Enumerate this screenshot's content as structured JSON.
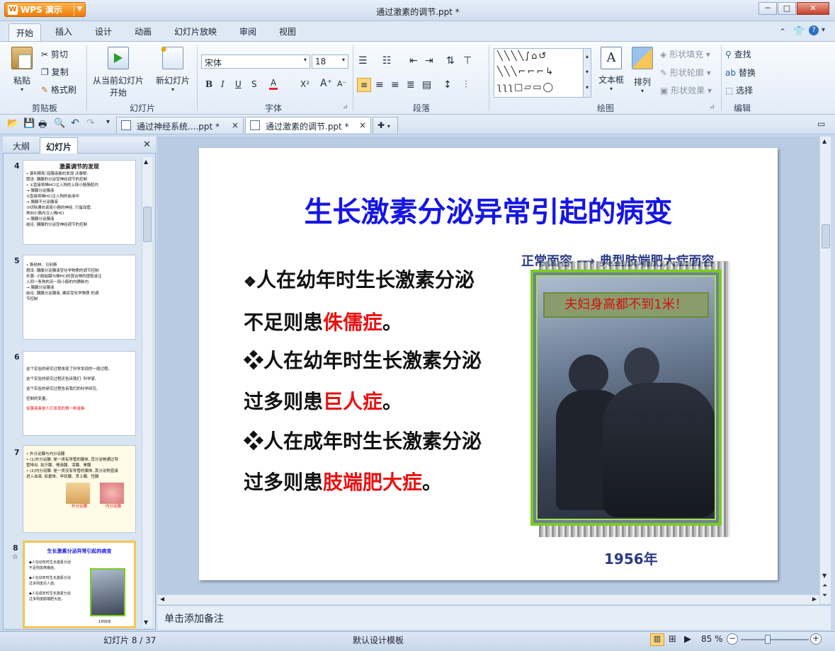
{
  "app": {
    "logo": "WPS 演示",
    "doc_title": "通过激素的调节.ppt *"
  },
  "window": {
    "min": "─",
    "max": "□",
    "close": "✕"
  },
  "menu": [
    "开始",
    "插入",
    "设计",
    "动画",
    "幻灯片放映",
    "审阅",
    "视图"
  ],
  "ribbon": {
    "clipboard": {
      "label": "剪贴板",
      "paste": "粘贴",
      "cut": "剪切",
      "copy": "复制",
      "format_painter": "格式刷"
    },
    "slides": {
      "label": "幻灯片",
      "from_current": "从当前幻灯片",
      "start": "开始",
      "new_slide": "新幻灯片"
    },
    "font": {
      "label": "字体",
      "name": "宋体",
      "size": "18"
    },
    "paragraph": {
      "label": "段落"
    },
    "drawing": {
      "label": "绘图",
      "textbox": "文本框",
      "arrange": "排列",
      "shape_fill": "形状填充",
      "shape_outline": "形状轮廓",
      "shape_effect": "形状效果"
    },
    "editing": {
      "label": "编辑",
      "find": "查找",
      "replace": "替换",
      "select": "选择"
    }
  },
  "doc_tabs": [
    {
      "label": "通过神经系统....ppt *"
    },
    {
      "label": "通过激素的调节.ppt *"
    }
  ],
  "left_panel": {
    "tab_outline": "大纲",
    "tab_slides": "幻灯片"
  },
  "thumbnails": [
    {
      "num": "4",
      "title": "激素调节的发现",
      "lines": [
        "• 斐利斯和 促胰液素的发现   沃泰默:",
        "假设: 胰腺的分泌受神经调节的控制",
        "• ①直接将稀HCl注入狗的上段小肠肠腔内",
        "  → 胰腺分泌胰液",
        "  ②直接将稀HCl注入狗的血液中",
        "  → 胰腺不分泌胰液",
        "  ③切除通向该段小肠的神经, 只留血管,",
        "  再向小肠内注入稀HCl",
        "  → 胰腺分泌胰液",
        "结论: 胰腺的分泌受神经调节的控制"
      ]
    },
    {
      "num": "5",
      "lines": [
        "• 斯他林、贝利斯",
        "假设: 胰腺分泌胰液受化学物质的调节控制",
        "步骤: 小肠粘膜与稀HCl的混合物的提取液注",
        "  入同一条狗的另一段小肠的内静脉内",
        "  → 胰腺分泌胰液",
        "结论: 胰腺分泌胰液, 确实受化学物质 的调",
        "  节控制"
      ]
    },
    {
      "num": "6",
      "lines": [
        "   这个实验的研究过程体现了科学发现的一般过程。",
        "   这个实验的研究过程还告诉我们: 科学家,",
        "   这个实验的研究过程告诉我们的科学研究,",
        "   控制的变量。",
        "   促胰液素是人们发现的第一种激素"
      ]
    },
    {
      "num": "7",
      "lines": [
        "• 外分泌腺与内分泌腺",
        "• (1)外分泌腺: 是一类有导管的腺体, 其分泌物通过导",
        "  管排出, 如汗腺、唾液腺、泪腺、胃腺",
        "• (2)内分泌腺: 是一类没有导管的腺体, 其分泌物直接",
        "  进入血液, 如垂体、甲状腺、肾上腺、性腺"
      ],
      "cap_left": "外分泌腺",
      "cap_right": "内分泌腺"
    },
    {
      "num": "8",
      "title": "生长激素分泌异常引起的病变",
      "lines": [
        "◆人在幼年时生长激素分泌",
        "不足则患侏儒症。",
        "◆人在幼年时生长激素分泌",
        "过多则患巨人症。",
        "◆人在成年时生长激素分泌",
        "过多则患肢端肥大症。"
      ],
      "cap": "1956年"
    }
  ],
  "slide": {
    "title": "生长激素分泌异常引起的病变",
    "bullets": [
      {
        "mark": "❖",
        "pre1": "人在幼年时生长激素分泌",
        "pre2": "不足则患",
        "disease": "侏儒症",
        "post": "。"
      },
      {
        "mark": "❖",
        "pre1": "人在幼年时生长激素分泌",
        "pre2": "过多则患",
        "disease": "巨人症",
        "post": "。"
      },
      {
        "mark": "❖",
        "pre1": "人在成年时生长激素分泌",
        "pre2": "过多则患",
        "disease": "肢端肥大症",
        "post": "。"
      }
    ],
    "top_label": "正常面容  ⟶  典型肢端肥大症面容",
    "caption": "夫妇身高都不到1米！",
    "year": "1956年"
  },
  "notes_placeholder": "单击添加备注",
  "status": {
    "slide_counter": "幻灯片 8 / 37",
    "template": "默认设计模板",
    "zoom": "85 %"
  },
  "colors": {
    "title_blue": "#1515e6",
    "disease_red": "#e81212",
    "frame_green": "#7ccc20"
  }
}
